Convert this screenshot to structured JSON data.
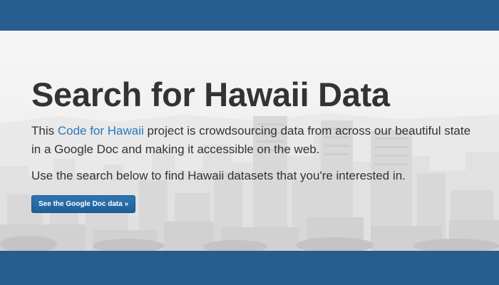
{
  "hero": {
    "title": "Search for Hawaii Data",
    "intro_before_link": "This ",
    "intro_link": "Code for Hawaii",
    "intro_after_link": " project is crowdsourcing data from across our beautiful state in a Google Doc and making it accessible on the web.",
    "search_hint": "Use the search below to find Hawaii datasets that you're interested in.",
    "button_label": "See the Google Doc data »"
  },
  "colors": {
    "bar": "#265c8e",
    "link": "#2a78b8",
    "button": "#2d76b3",
    "text": "#333333"
  }
}
